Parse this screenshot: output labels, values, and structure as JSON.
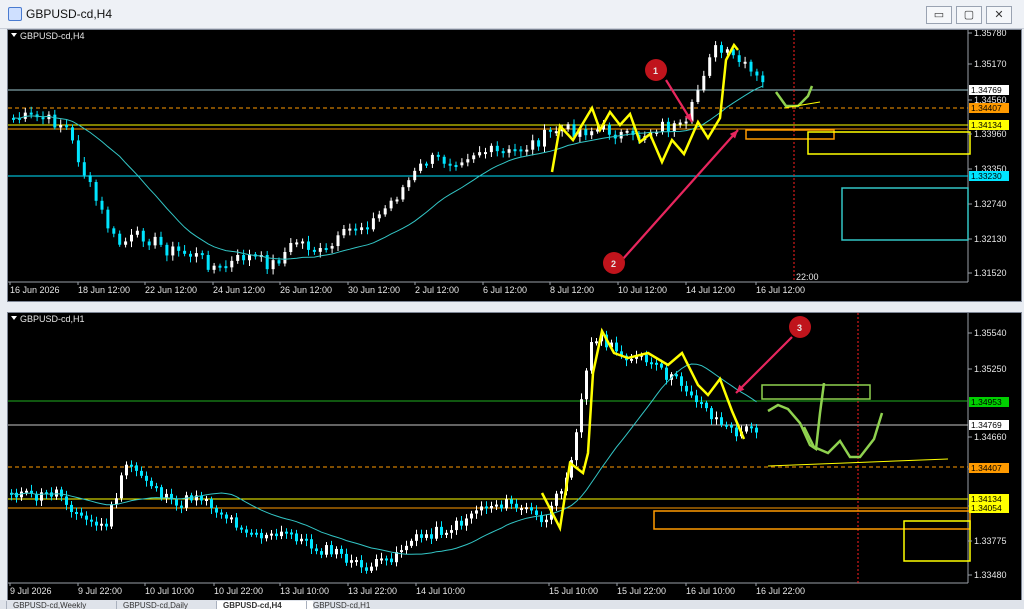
{
  "window": {
    "title": "GBPUSD-cd,H4",
    "btn_min": "▭",
    "btn_max": "▢",
    "btn_close": "✕"
  },
  "top_chart": {
    "label": "GBPUSD-cd,H4",
    "price_ticks": [
      "1.35780",
      "1.35170",
      "1.34560",
      "1.33960",
      "1.33350",
      "1.32740",
      "1.32130",
      "1.31520"
    ],
    "markers": [
      {
        "text": "1.34769",
        "bg": "#ffffff",
        "fg": "#000000"
      },
      {
        "text": "1.34407",
        "bg": "#ff9a00",
        "fg": "#000000"
      },
      {
        "text": "1.34134",
        "bg": "#ffff00",
        "fg": "#000000"
      },
      {
        "text": "1.33230",
        "bg": "#00e5ff",
        "fg": "#000000"
      }
    ],
    "time_ticks": [
      "16 Jun 2026",
      "18 Jun 12:00",
      "22 Jun 12:00",
      "24 Jun 12:00",
      "26 Jun 12:00",
      "30 Jun 12:00",
      "2 Jul 12:00",
      "6 Jul 12:00",
      "8 Jul 12:00",
      "10 Jul 12:00",
      "14 Jul 12:00",
      "16 Jul 12:00"
    ],
    "vline_label": "22:00",
    "callouts": [
      "1",
      "2"
    ]
  },
  "bottom_chart": {
    "label": "GBPUSD-cd,H1",
    "price_ticks": [
      "1.35540",
      "1.35250",
      "1.34660",
      "1.34365",
      "1.34054",
      "1.33775",
      "1.33480"
    ],
    "markers": [
      {
        "text": "1.34953",
        "bg": "#00d000",
        "fg": "#000000"
      },
      {
        "text": "1.34769",
        "bg": "#ffffff",
        "fg": "#000000"
      },
      {
        "text": "1.34407",
        "bg": "#ff9a00",
        "fg": "#000000"
      },
      {
        "text": "1.34134",
        "bg": "#ffff00",
        "fg": "#000000"
      },
      {
        "text": "1.34054",
        "bg": "#ffff00",
        "fg": "#000000"
      }
    ],
    "time_ticks": [
      "9 Jul 2026",
      "9 Jul 22:00",
      "10 Jul 10:00",
      "10 Jul 22:00",
      "13 Jul 10:00",
      "13 Jul 22:00",
      "14 Jul 10:00",
      "15 Jul 10:00",
      "15 Jul 22:00",
      "16 Jul 10:00",
      "16 Jul 22:00"
    ],
    "callouts": [
      "3"
    ]
  },
  "tabs": [
    "GBPUSD-cd,Weekly",
    "GBPUSD-cd,Daily",
    "GBPUSD-cd,H4",
    "GBPUSD-cd,H1"
  ],
  "colors": {
    "up": "#ffffff",
    "down": "#00e5ff",
    "ma": "#33c6c6",
    "yellow": "#ffff00",
    "green": "#8fd14f",
    "orange": "#ff9a00",
    "arrow": "#e8265e",
    "callout": "#c0141c"
  }
}
